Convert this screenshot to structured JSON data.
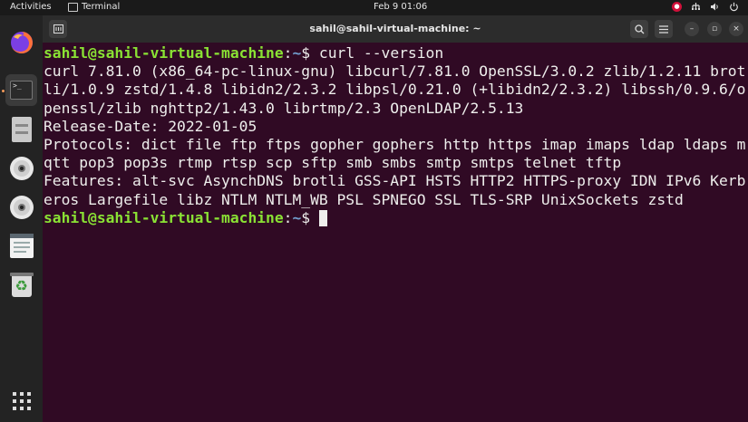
{
  "topbar": {
    "activities": "Activities",
    "app_name": "Terminal",
    "clock": "Feb 9  01:06"
  },
  "window": {
    "title": "sahil@sahil-virtual-machine: ~"
  },
  "terminal": {
    "prompt_user": "sahil@sahil-virtual-machine",
    "prompt_colon": ":",
    "prompt_path": "~",
    "prompt_symbol": "$ ",
    "command": "curl --version",
    "output": [
      "curl 7.81.0 (x86_64-pc-linux-gnu) libcurl/7.81.0 OpenSSL/3.0.2 zlib/1.2.11 brot",
      "li/1.0.9 zstd/1.4.8 libidn2/2.3.2 libpsl/0.21.0 (+libidn2/2.3.2) libssh/0.9.6/o",
      "penssl/zlib nghttp2/1.43.0 librtmp/2.3 OpenLDAP/2.5.13",
      "Release-Date: 2022-01-05",
      "Protocols: dict file ftp ftps gopher gophers http https imap imaps ldap ldaps m",
      "qtt pop3 pop3s rtmp rtsp scp sftp smb smbs smtp smtps telnet tftp",
      "Features: alt-svc AsynchDNS brotli GSS-API HSTS HTTP2 HTTPS-proxy IDN IPv6 Kerb",
      "eros Largefile libz NTLM NTLM_WB PSL SPNEGO SSL TLS-SRP UnixSockets zstd"
    ]
  },
  "colors": {
    "terminal_bg": "#300a24",
    "prompt_user": "#8ae234",
    "prompt_path": "#729fcf",
    "text": "#eeeeec"
  }
}
